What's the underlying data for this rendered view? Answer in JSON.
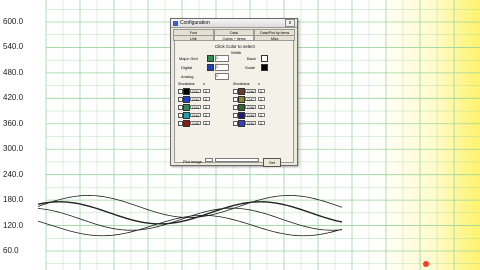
{
  "chart_data": {
    "type": "line",
    "y_tick_labels": [
      "600.0",
      "540.0",
      "480.0",
      "420.0",
      "360.0",
      "300.0",
      "240.0",
      "180.0",
      "120.0",
      "60.0"
    ],
    "ylim": [
      60,
      600
    ],
    "grid": true,
    "series": [
      {
        "color": "#222222",
        "amplitude": 26,
        "offset": 165
      },
      {
        "color": "#222222",
        "amplitude": 26,
        "offset": 150
      },
      {
        "color": "#222222",
        "amplitude": 26,
        "offset": 135
      },
      {
        "color": "#222222",
        "amplitude": 24,
        "offset": 120
      }
    ]
  },
  "colors": {
    "grid": "#9dd49d",
    "background_right": "#fff36a",
    "accent_dot": "#ff3b1f"
  },
  "dialog": {
    "title": "Configuration",
    "close_label": "x",
    "tabs_row1": [
      "Font",
      "Data",
      "Data/Plot by items"
    ],
    "tabs_row2": [
      "Unit",
      "Colors + items",
      "Misc"
    ],
    "heading": "Click Color to select",
    "width_label": "Width",
    "rows": [
      {
        "label": "Major Grid",
        "value": "1"
      },
      {
        "label": "Digital",
        "value": "1"
      },
      {
        "label": "Analog",
        "value": "1"
      }
    ],
    "right_labels": [
      "Back",
      "Scale"
    ],
    "col_headers": [
      "Show",
      "Value",
      "n",
      "Show",
      "Value",
      "n"
    ],
    "channels_left": [
      {
        "name": "CH1",
        "n": "0",
        "color": "#000000"
      },
      {
        "name": "CH2",
        "n": "0",
        "color": "#1f3fbf"
      },
      {
        "name": "CH3",
        "n": "0",
        "color": "#2e8b57"
      },
      {
        "name": "CH4",
        "n": "0",
        "color": "#20a0b0"
      },
      {
        "name": "CH5",
        "n": "0",
        "color": "#8b1a1a"
      }
    ],
    "channels_right": [
      {
        "name": "CH6",
        "n": "0",
        "color": "#6b3a2a"
      },
      {
        "name": "CH7",
        "n": "0",
        "color": "#8a8a2a"
      },
      {
        "name": "CH8",
        "n": "0",
        "color": "#2a6b2a"
      },
      {
        "name": "CH9",
        "n": "0",
        "color": "#1a1a8b"
      },
      {
        "name": "CH0",
        "n": "0",
        "color": "#3a3ad0"
      }
    ],
    "plot_image_label": "Plot image",
    "set_label": "Set"
  }
}
